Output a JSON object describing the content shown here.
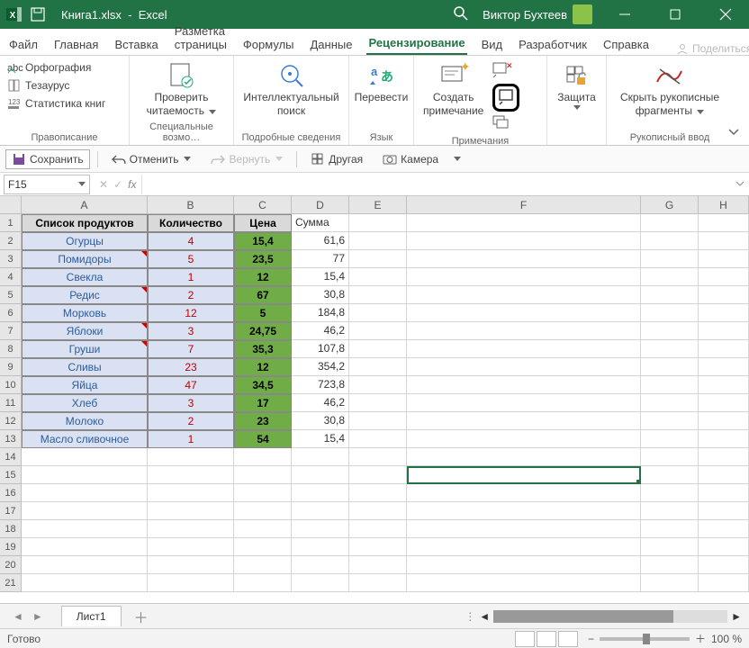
{
  "title": {
    "doc": "Книга1.xlsx",
    "app": "Excel",
    "user": "Виктор Бухтеев"
  },
  "menu": {
    "file": "Файл",
    "home": "Главная",
    "insert": "Вставка",
    "layout": "Разметка страницы",
    "formulas": "Формулы",
    "data": "Данные",
    "review": "Рецензирование",
    "view": "Вид",
    "developer": "Разработчик",
    "help": "Справка",
    "share": "Поделиться"
  },
  "ribbon": {
    "proofing": {
      "spelling": "Орфография",
      "thesaurus": "Тезаурус",
      "stats": "Статистика книг",
      "label": "Правописание"
    },
    "access": {
      "check": "Проверить",
      "check2": "читаемость",
      "label": "Специальные возмо…"
    },
    "insights": {
      "smart": "Интеллектуальный",
      "smart2": "поиск",
      "label": "Подробные сведения"
    },
    "lang": {
      "translate": "Перевести",
      "label": "Язык"
    },
    "comments": {
      "new": "Создать",
      "new2": "примечание",
      "label": "Примечания"
    },
    "protect": {
      "protect": "Защита",
      "label": ""
    },
    "ink": {
      "hide": "Скрыть рукописные",
      "hide2": "фрагменты",
      "label": "Рукописный ввод"
    }
  },
  "qat": {
    "save": "Сохранить",
    "undo": "Отменить",
    "redo": "Вернуть",
    "other": "Другая",
    "camera": "Камера"
  },
  "namebox": "F15",
  "headers": {
    "A": "Список продуктов",
    "B": "Количество",
    "C": "Цена",
    "D": "Сумма"
  },
  "cols": [
    "A",
    "B",
    "C",
    "D",
    "E",
    "F",
    "G",
    "H"
  ],
  "chart_data": {
    "type": "table",
    "columns": [
      "Список продуктов",
      "Количество",
      "Цена",
      "Сумма"
    ],
    "rows": [
      {
        "a": "Огурцы",
        "b": "4",
        "c": "15,4",
        "d": "61,6"
      },
      {
        "a": "Помидоры",
        "b": "5",
        "c": "23,5",
        "d": "77"
      },
      {
        "a": "Свекла",
        "b": "1",
        "c": "12",
        "d": "15,4"
      },
      {
        "a": "Редис",
        "b": "2",
        "c": "67",
        "d": "30,8"
      },
      {
        "a": "Морковь",
        "b": "12",
        "c": "5",
        "d": "184,8"
      },
      {
        "a": "Яблоки",
        "b": "3",
        "c": "24,75",
        "d": "46,2"
      },
      {
        "a": "Груши",
        "b": "7",
        "c": "35,3",
        "d": "107,8"
      },
      {
        "a": "Сливы",
        "b": "23",
        "c": "12",
        "d": "354,2"
      },
      {
        "a": "Яйца",
        "b": "47",
        "c": "34,5",
        "d": "723,8"
      },
      {
        "a": "Хлеб",
        "b": "3",
        "c": "17",
        "d": "46,2"
      },
      {
        "a": "Молоко",
        "b": "2",
        "c": "23",
        "d": "30,8"
      },
      {
        "a": "Масло сливочное",
        "b": "1",
        "c": "54",
        "d": "15,4"
      }
    ]
  },
  "sheet": {
    "name": "Лист1"
  },
  "status": {
    "ready": "Готово",
    "zoom": "100 %"
  }
}
